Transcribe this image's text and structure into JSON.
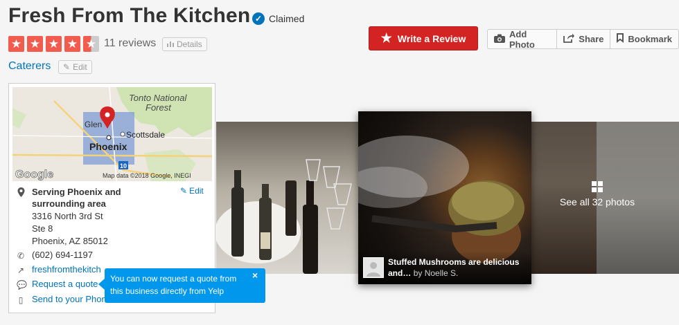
{
  "header": {
    "business_name": "Fresh From The Kitchen",
    "claimed_label": "Claimed",
    "review_count": "11 reviews",
    "details_label": "Details",
    "rating": 4.5,
    "category": "Caterers",
    "edit_label": "Edit"
  },
  "actions": {
    "write_review": "Write a Review",
    "add_photo": "Add Photo",
    "share": "Share",
    "bookmark": "Bookmark"
  },
  "map": {
    "labels": {
      "tonto": "Tonto National",
      "forest": "Forest",
      "glendale": "Glen",
      "scottsdale": "Scottsdale",
      "phoenix": "Phoenix",
      "route": "10"
    },
    "google": "Google",
    "attribution": "Map data ©2018 Google, INEGI"
  },
  "info": {
    "service_area": "Serving Phoenix and surrounding area",
    "edit": "Edit",
    "address1": "3316 North 3rd St",
    "address2": "Ste 8",
    "address3": "Phoenix, AZ 85012",
    "phone": "(602) 694-1197",
    "website": "freshfromthekitch",
    "quote": "Request a quote",
    "send": "Send to your Phon"
  },
  "photos": {
    "caption": "Stuffed Mushrooms are delicious and…",
    "by": "by Noelle S.",
    "see_all": "See all 32 photos"
  },
  "tooltip": {
    "text": "You can now request a quote from this business directly from Yelp",
    "close": "×"
  },
  "colors": {
    "brand_red": "#d32323",
    "star_red": "#f15c4f",
    "link_blue": "#0073bb",
    "tooltip_blue": "#0097ec"
  }
}
